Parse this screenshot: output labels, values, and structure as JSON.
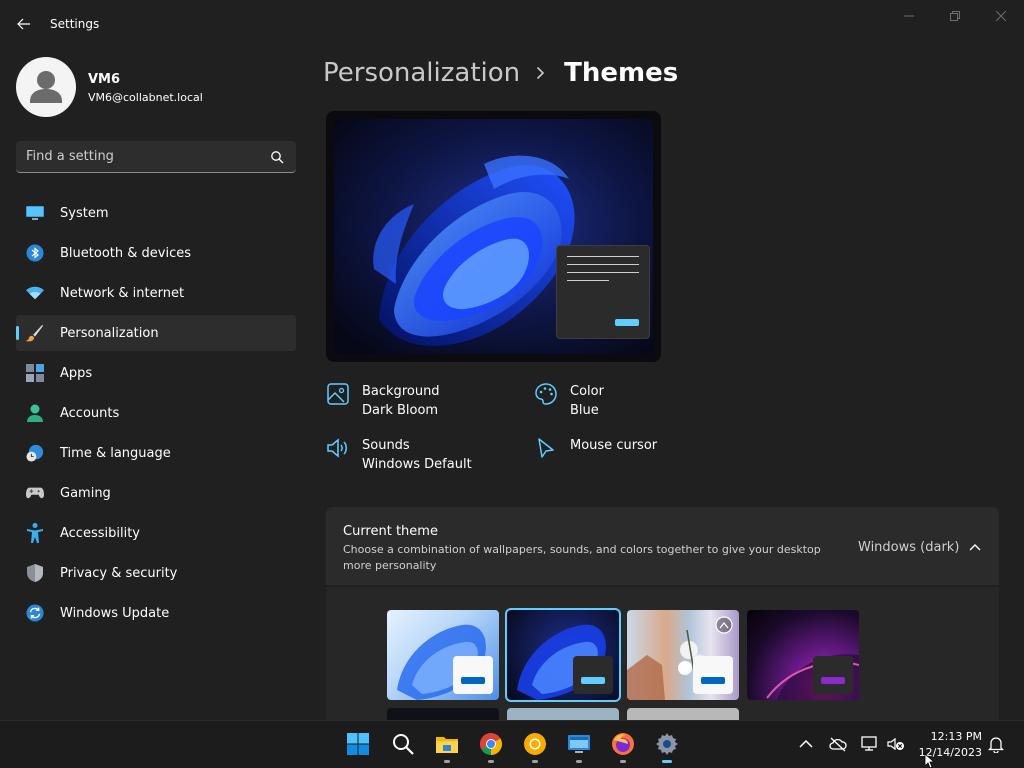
{
  "window": {
    "title": "Settings",
    "controls": [
      "minimize-icon",
      "restore-icon",
      "close-icon"
    ]
  },
  "profile": {
    "name": "VM6",
    "email": "VM6@collabnet.local"
  },
  "search": {
    "placeholder": "Find a setting",
    "value": ""
  },
  "sidebar": {
    "items": [
      {
        "label": "System",
        "icon": "monitor-icon",
        "active": false
      },
      {
        "label": "Bluetooth & devices",
        "icon": "bluetooth-icon",
        "active": false
      },
      {
        "label": "Network & internet",
        "icon": "wifi-icon",
        "active": false
      },
      {
        "label": "Personalization",
        "icon": "brush-icon",
        "active": true
      },
      {
        "label": "Apps",
        "icon": "apps-icon",
        "active": false
      },
      {
        "label": "Accounts",
        "icon": "person-icon",
        "active": false
      },
      {
        "label": "Time & language",
        "icon": "clock-globe-icon",
        "active": false
      },
      {
        "label": "Gaming",
        "icon": "gamepad-icon",
        "active": false
      },
      {
        "label": "Accessibility",
        "icon": "accessibility-icon",
        "active": false
      },
      {
        "label": "Privacy & security",
        "icon": "shield-icon",
        "active": false
      },
      {
        "label": "Windows Update",
        "icon": "update-icon",
        "active": false
      }
    ]
  },
  "breadcrumb": {
    "parent": "Personalization",
    "current": "Themes"
  },
  "summary": {
    "background": {
      "label": "Background",
      "value": "Dark Bloom"
    },
    "color": {
      "label": "Color",
      "value": "Blue"
    },
    "sounds": {
      "label": "Sounds",
      "value": "Windows Default"
    },
    "mouse": {
      "label": "Mouse cursor"
    }
  },
  "current_theme": {
    "title": "Current theme",
    "description": "Choose a combination of wallpapers, sounds, and colors together to give your desktop more personality",
    "value": "Windows (dark)",
    "expanded": true
  },
  "colors": {
    "accent": "#60cdff",
    "background": "#202020",
    "card": "#2b2b2b"
  },
  "taskbar": {
    "apps": [
      "windows-start-icon",
      "search-icon",
      "file-explorer-icon",
      "chrome-icon",
      "chrome-canary-icon",
      "remote-desktop-icon",
      "firefox-icon",
      "settings-icon"
    ],
    "time": "12:13 PM",
    "date": "12/14/2023"
  }
}
